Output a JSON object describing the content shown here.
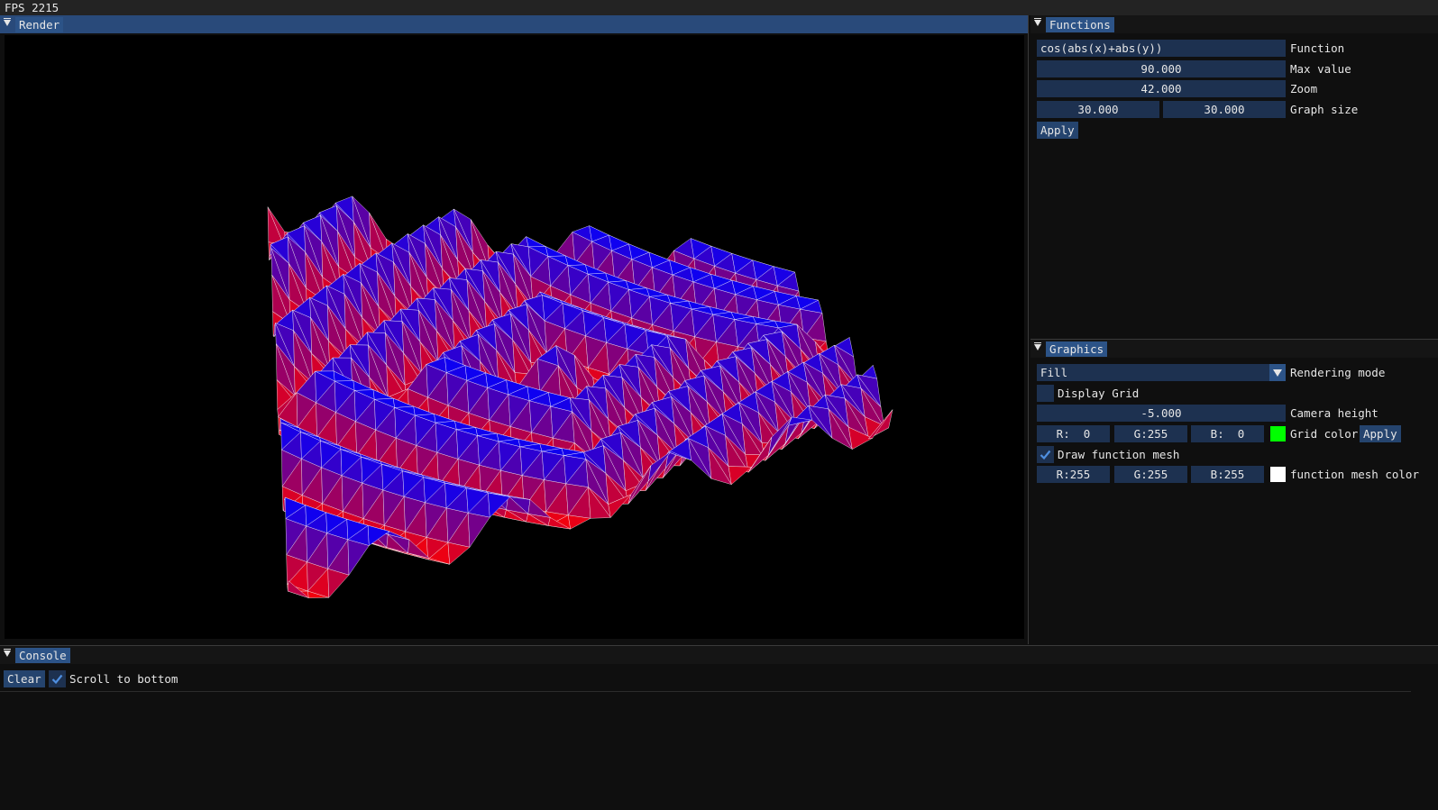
{
  "topbar": {
    "fps": "FPS 2215"
  },
  "render": {
    "tab": "Render"
  },
  "functions": {
    "tab": "Functions",
    "function_value": "cos(abs(x)+abs(y))",
    "function_label": "Function",
    "max_value": "90.000",
    "max_value_label": "Max value",
    "zoom": "42.000",
    "zoom_label": "Zoom",
    "graph_size_x": "30.000",
    "graph_size_y": "30.000",
    "graph_size_label": "Graph size",
    "apply": "Apply"
  },
  "graphics": {
    "tab": "Graphics",
    "rendering_mode_value": "Fill",
    "rendering_mode_label": "Rendering mode",
    "display_grid_label": "Display Grid",
    "display_grid_checked": false,
    "camera_height": "-5.000",
    "camera_height_label": "Camera height",
    "grid_r": "R:  0",
    "grid_g": "G:255",
    "grid_b": "B:  0",
    "grid_color_label": "Grid color",
    "grid_color": "#00ff00",
    "grid_apply": "Apply",
    "draw_mesh_label": "Draw function mesh",
    "draw_mesh_checked": true,
    "mesh_r": "R:255",
    "mesh_g": "G:255",
    "mesh_b": "B:255",
    "mesh_color_label": "function mesh color",
    "mesh_color": "#ffffff"
  },
  "console": {
    "tab": "Console",
    "clear": "Clear",
    "scroll_label": "Scroll to bottom",
    "scroll_checked": true
  },
  "colors": {
    "surface_low": "#0000ff",
    "surface_high": "#ff0000",
    "mesh": "#ffffff"
  }
}
